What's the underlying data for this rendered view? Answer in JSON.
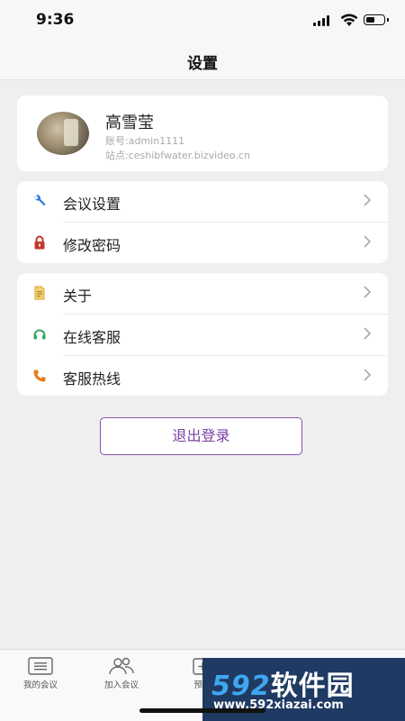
{
  "status_bar": {
    "time": "9:36"
  },
  "nav": {
    "title": "设置"
  },
  "profile": {
    "name": "高雪莹",
    "account": "账号:admin1111",
    "site": "站点:ceshibfwater.bizvideo.cn"
  },
  "menu_group_1": [
    {
      "label": "会议设置",
      "icon": "wrench-icon",
      "icon_color": "#2f7fd8"
    },
    {
      "label": "修改密码",
      "icon": "lock-icon",
      "icon_color": "#c0392b"
    }
  ],
  "menu_group_2": [
    {
      "label": "关于",
      "icon": "document-icon",
      "icon_color": "#e0b43a"
    },
    {
      "label": "在线客服",
      "icon": "headset-icon",
      "icon_color": "#3ba55c"
    },
    {
      "label": "客服热线",
      "icon": "phone-icon",
      "icon_color": "#e67e22"
    }
  ],
  "logout_label": "退出登录",
  "tab_bar": [
    {
      "label": "我的会议",
      "icon": "list-icon"
    },
    {
      "label": "加入会议",
      "icon": "people-icon"
    },
    {
      "label": "预约",
      "icon": "calendar-plus-icon"
    }
  ],
  "watermark": {
    "logo_num": "592",
    "logo_text": "软件园",
    "url": "www.592xiazai.com"
  },
  "colors": {
    "accent": "#7b3fa6",
    "background": "#efefef",
    "card": "#ffffff"
  }
}
